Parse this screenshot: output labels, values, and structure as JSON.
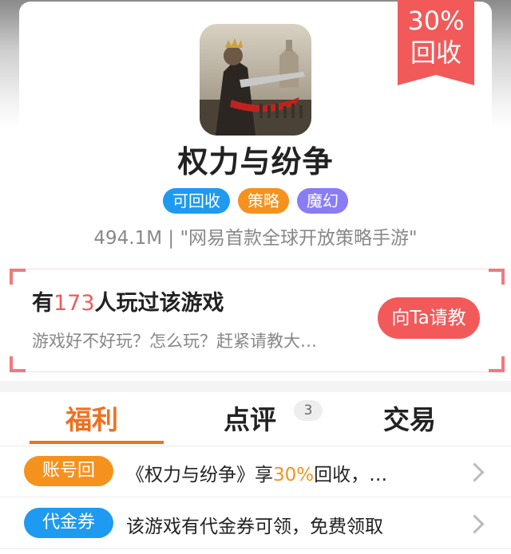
{
  "game": {
    "title": "权力与纷争",
    "tags": [
      {
        "label": "可回收",
        "color": "#1e9bf0"
      },
      {
        "label": "策略",
        "color": "#f5921e"
      },
      {
        "label": "魔幻",
        "color": "#8a7cf4"
      }
    ],
    "subline": "494.1M | \"网易首款全球开放策略手游\""
  },
  "rebate": {
    "line1": "30%",
    "line2": "回收",
    "color": "#f25a5a"
  },
  "ask": {
    "prefix": "有",
    "count": "173",
    "suffix": "人玩过该游戏",
    "subtitle": "游戏好不好玩？怎么玩？赶紧请教大…",
    "button": "向Ta请教"
  },
  "tabs": [
    {
      "label": "福利",
      "active": true
    },
    {
      "label": "点评",
      "badge": "3"
    },
    {
      "label": "交易"
    }
  ],
  "benefits": [
    {
      "pill": "账号回",
      "pill_color": "#f5921e",
      "text_before": "《权力与纷争》享",
      "highlight": "30%",
      "text_after": "回收，…"
    },
    {
      "pill": "代金券",
      "pill_color": "#1e9bf0",
      "text_before": "该游戏有代金券可领，免费领取",
      "highlight": "",
      "text_after": ""
    }
  ],
  "icons": {
    "app": "game-icon-king-warrior",
    "chevron": "chevron-right-icon"
  },
  "colors": {
    "accent": "#f0701e",
    "ask_red": "#f25a5a"
  }
}
